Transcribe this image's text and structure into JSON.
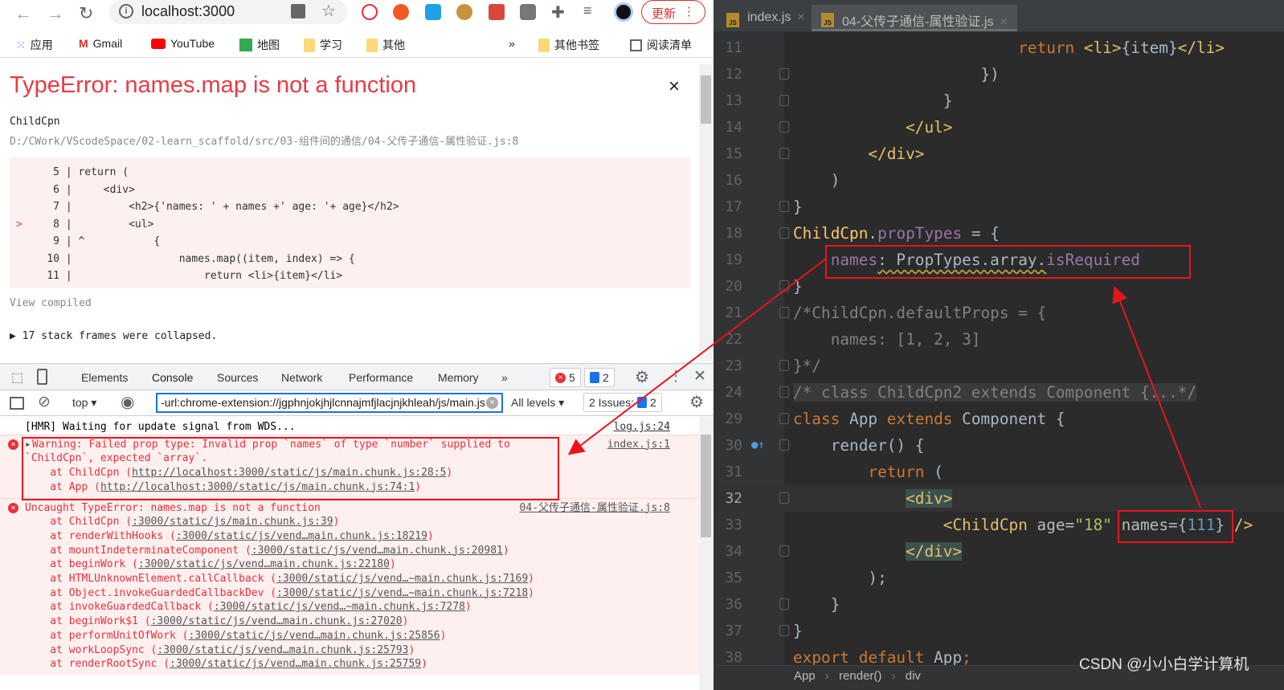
{
  "browser": {
    "url": "localhost:3000",
    "update_label": "更新",
    "bookmarks": [
      {
        "label": "应用",
        "icon": "apps-grid-icon"
      },
      {
        "label": "Gmail",
        "icon": "gmail-icon"
      },
      {
        "label": "YouTube",
        "icon": "youtube-icon"
      },
      {
        "label": "地图",
        "icon": "maps-icon"
      },
      {
        "label": "学习",
        "icon": "folder-icon"
      },
      {
        "label": "其他",
        "icon": "folder-icon"
      }
    ],
    "more_bookmarks": "»",
    "other_bookmarks": "其他书签",
    "reading_list": "阅读清单"
  },
  "overlay": {
    "title": "TypeError: names.map is not a function",
    "close": "×",
    "component": "ChildCpn",
    "path": "D:/CWork/VScodeSpace/02-learn_scaffold/src/03-组件间的通信/04-父传子通信-属性验证.js:8",
    "code_lines": [
      {
        "mark": " ",
        "n": "5",
        "code": "return ("
      },
      {
        "mark": " ",
        "n": "6",
        "code": "    <div>"
      },
      {
        "mark": " ",
        "n": "7",
        "code": "        <h2>{'names: ' + names +' age: '+ age}</h2>"
      },
      {
        "mark": ">",
        "n": "8",
        "code": "        <ul>"
      },
      {
        "mark": " ",
        "n": "9",
        "code": "^           {"
      },
      {
        "mark": " ",
        "n": "10",
        "code": "                names.map((item, index) => {"
      },
      {
        "mark": " ",
        "n": "11",
        "code": "                    return <li>{item}</li>"
      }
    ],
    "view_compiled": "View compiled",
    "collapsed": "▶ 17 stack frames were collapsed."
  },
  "devtools": {
    "tabs": [
      "Elements",
      "Console",
      "Sources",
      "Network",
      "Performance",
      "Memory"
    ],
    "active_tab": "Console",
    "more_tabs": "»",
    "error_count": "5",
    "issue_count": "2",
    "context": "top",
    "filter_value": "-url:chrome-extension://jgphnjokjhjlcnnajmfjlacjnjkhleah/js/main.js",
    "levels": "All levels",
    "issues_label": "2 Issues:",
    "issues_num": "2"
  },
  "console": {
    "hmr": {
      "text": "[HMR] Waiting for update signal from WDS...",
      "src": "log.js:24"
    },
    "warning": {
      "lines": [
        "Warning: Failed prop type: Invalid prop `names` of type `number` supplied to",
        "`ChildCpn`, expected `array`."
      ],
      "src": "index.js:1",
      "frames": [
        {
          "fn": "ChildCpn",
          "loc": "http://localhost:3000/static/js/main.chunk.js:28:5"
        },
        {
          "fn": "App",
          "loc": "http://localhost:3000/static/js/main.chunk.js:74:1"
        }
      ]
    },
    "error": {
      "text": "Uncaught TypeError: names.map is not a function",
      "src": "04-父传子通信-属性验证.js:8",
      "frames": [
        {
          "fn": "ChildCpn",
          "loc": ":3000/static/js/main.chunk.js:39"
        },
        {
          "fn": "renderWithHooks",
          "loc": ":3000/static/js/vend…main.chunk.js:18219"
        },
        {
          "fn": "mountIndeterminateComponent",
          "loc": ":3000/static/js/vend…main.chunk.js:20981"
        },
        {
          "fn": "beginWork",
          "loc": ":3000/static/js/vend…main.chunk.js:22180"
        },
        {
          "fn": "HTMLUnknownElement.callCallback",
          "loc": ":3000/static/js/vend…~main.chunk.js:7169"
        },
        {
          "fn": "Object.invokeGuardedCallbackDev",
          "loc": ":3000/static/js/vend…~main.chunk.js:7218"
        },
        {
          "fn": "invokeGuardedCallback",
          "loc": ":3000/static/js/vend…~main.chunk.js:7278"
        },
        {
          "fn": "beginWork$1",
          "loc": ":3000/static/js/vend…main.chunk.js:27020"
        },
        {
          "fn": "performUnitOfWork",
          "loc": ":3000/static/js/vend…main.chunk.js:25856"
        },
        {
          "fn": "workLoopSync",
          "loc": ":3000/static/js/vend…main.chunk.js:25793"
        },
        {
          "fn": "renderRootSync",
          "loc": ":3000/static/js/vend…main.chunk.js:25759"
        }
      ]
    }
  },
  "editor": {
    "tabs": [
      {
        "label": "index.js",
        "active": false
      },
      {
        "label": "04-父传子通信-属性验证.js",
        "active": true
      }
    ],
    "current_line": "32",
    "lines": [
      {
        "n": "11",
        "t": [
          [
            "                        return ",
            "kw"
          ],
          [
            "<li>",
            "tag"
          ],
          [
            "{item}",
            "pl"
          ],
          [
            "</li>",
            "tag"
          ]
        ]
      },
      {
        "n": "12",
        "t": [
          [
            "                    })",
            "pl"
          ]
        ]
      },
      {
        "n": "13",
        "t": [
          [
            "                }",
            "pl"
          ]
        ]
      },
      {
        "n": "14",
        "t": [
          [
            "            ",
            "pl"
          ],
          [
            "</ul>",
            "tag"
          ]
        ]
      },
      {
        "n": "15",
        "t": [
          [
            "        ",
            "pl"
          ],
          [
            "</div>",
            "tag"
          ]
        ]
      },
      {
        "n": "16",
        "t": [
          [
            "    )",
            "pl"
          ]
        ]
      },
      {
        "n": "17",
        "t": [
          [
            "}",
            "pl"
          ]
        ]
      },
      {
        "n": "18",
        "t": [
          [
            "ChildCpn",
            "cls"
          ],
          [
            ".",
            "pl"
          ],
          [
            "propTypes",
            "pu"
          ],
          [
            " = {",
            "pl"
          ]
        ]
      },
      {
        "n": "19",
        "t": [
          [
            "    ",
            "pl"
          ],
          [
            "names",
            "pu"
          ],
          [
            ": PropTypes.array.",
            "pl"
          ],
          [
            "isRequired",
            "pu"
          ]
        ]
      },
      {
        "n": "20",
        "t": [
          [
            "}",
            "pl"
          ]
        ]
      },
      {
        "n": "21",
        "t": [
          [
            "/*ChildCpn.defaultProps = {",
            "cm"
          ]
        ]
      },
      {
        "n": "22",
        "t": [
          [
            "    names: [1, 2, 3]",
            "cm"
          ]
        ]
      },
      {
        "n": "23",
        "t": [
          [
            "}*/",
            "cm"
          ]
        ]
      },
      {
        "n": "24",
        "t": [
          [
            "/* class ChildCpn2 extends Component {...*/",
            "cm"
          ]
        ]
      },
      {
        "n": "29",
        "t": [
          [
            "class ",
            "kw"
          ],
          [
            "App ",
            "pl"
          ],
          [
            "extends ",
            "kw"
          ],
          [
            "Component {",
            "pl"
          ]
        ]
      },
      {
        "n": "30",
        "t": [
          [
            "    render() {",
            "pl"
          ]
        ]
      },
      {
        "n": "31",
        "t": [
          [
            "        ",
            "pl"
          ],
          [
            "return ",
            "kw"
          ],
          [
            "(",
            "pl"
          ]
        ]
      },
      {
        "n": "32",
        "t": [
          [
            "            ",
            "pl"
          ],
          [
            "<div>",
            "tag"
          ]
        ]
      },
      {
        "n": "33",
        "t": [
          [
            "                ",
            "pl"
          ],
          [
            "<ChildCpn ",
            "tag"
          ],
          [
            "age=",
            "attr"
          ],
          [
            "\"18\"",
            "str"
          ],
          [
            " names=",
            "attr"
          ],
          [
            "{",
            "pl"
          ],
          [
            "111",
            "num"
          ],
          [
            "}",
            "pl"
          ],
          [
            " />",
            "tag"
          ]
        ]
      },
      {
        "n": "34",
        "t": [
          [
            "            ",
            "pl"
          ],
          [
            "</div>",
            "tag"
          ]
        ]
      },
      {
        "n": "35",
        "t": [
          [
            "        );",
            "pl"
          ]
        ]
      },
      {
        "n": "36",
        "t": [
          [
            "    }",
            "pl"
          ]
        ]
      },
      {
        "n": "37",
        "t": [
          [
            "}",
            "pl"
          ]
        ]
      },
      {
        "n": "38",
        "t": [
          [
            "export default ",
            "kw"
          ],
          [
            "App",
            "pl"
          ],
          [
            ";",
            "kw"
          ]
        ]
      }
    ],
    "breadcrumb": [
      "App",
      "render()",
      "div"
    ],
    "breadcrumb_sep": "›"
  },
  "watermark": "CSDN @小小白学计算机",
  "colors": {
    "annotation": "#e8141c",
    "error": "#e8303b",
    "editor_bg": "#2b2b2b"
  }
}
